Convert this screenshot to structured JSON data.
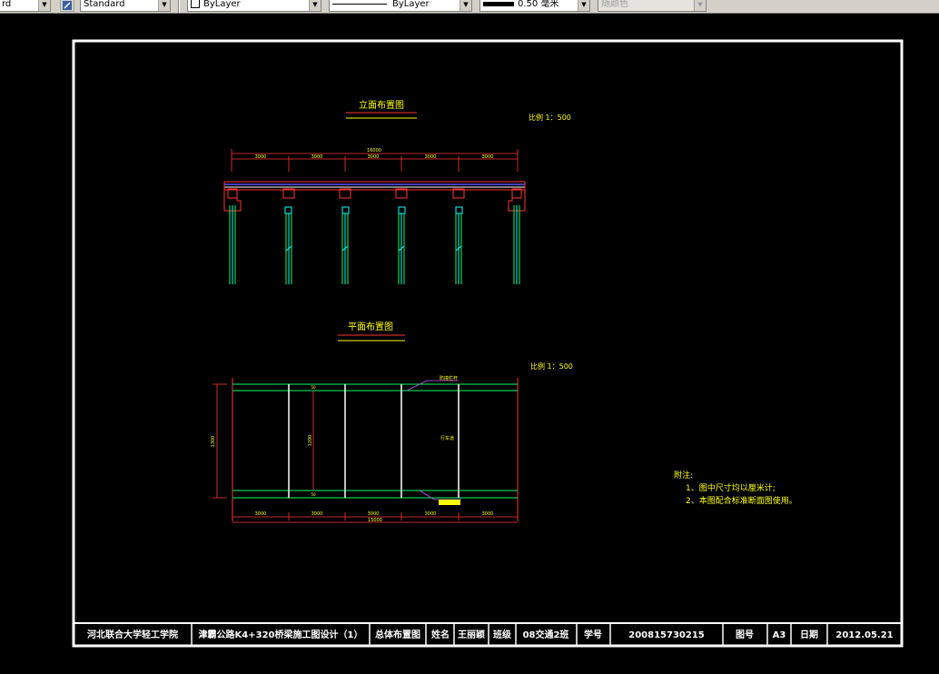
{
  "toolbar": {
    "style_partial": "rd",
    "text_style": "Standard",
    "layer": "ByLayer",
    "linetype": "ByLayer",
    "lineweight": "0.50 毫米",
    "color": "随颜色"
  },
  "drawing": {
    "elevation": {
      "title": "立面布置图",
      "scale": "比例 1：500",
      "total_dim": "16000",
      "span_dims": [
        "3000",
        "3000",
        "3000",
        "3000",
        "3000"
      ]
    },
    "plan": {
      "title": "平面布置图",
      "scale": "比例 1：500",
      "width_dim": "1300",
      "inner_dim": "1200",
      "edge_dim_top": "50",
      "edge_dim_bottom": "50",
      "label_rail": "防撞栏杆",
      "label_deck": "行车道",
      "span_dims": [
        "3000",
        "3000",
        "3000",
        "3000",
        "3000"
      ],
      "total_dim": "15000"
    },
    "notes": {
      "title": "附注:",
      "items": [
        "1、图中尺寸均以厘米计;",
        "2、本图配合标准断面图使用。"
      ]
    }
  },
  "title_block": {
    "school": "河北联合大学轻工学院",
    "project": "津霸公路K4+320桥梁施工图设计（1）",
    "sheet_name": "总体布置图",
    "name_label": "姓名",
    "name_value": "王丽颖",
    "class_label": "班级",
    "class_value": "08交通2班",
    "id_label": "学号",
    "id_value": "200815730215",
    "drawing_no_label": "图号",
    "drawing_no_value": "A3",
    "date_label": "日期",
    "date_value": "2012.05.21"
  },
  "colors": {
    "background": "#000000",
    "frame": "#ffffff",
    "dimension": "#ff3333",
    "pier": "#00ff66",
    "column_center": "#00ffff",
    "deck_line": "#5555ff",
    "text": "#ffff00",
    "leader": "#cc55ff"
  }
}
